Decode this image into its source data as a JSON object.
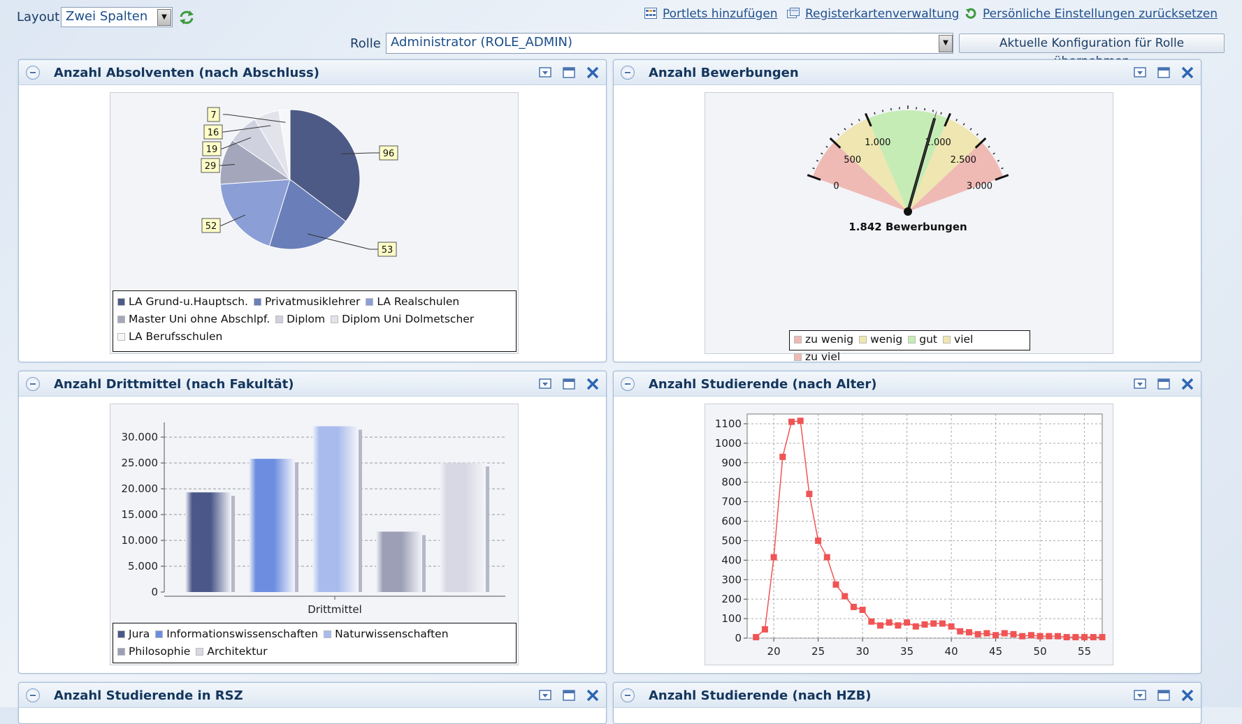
{
  "toolbar": {
    "layout_label": "Layout",
    "layout_value": "Zwei Spalten",
    "role_label": "Rolle",
    "role_value": "Administrator (ROLE_ADMIN)",
    "apply_button": "Aktuelle Konfiguration für Rolle übernehmen",
    "links": {
      "add_portlets": "Portlets hinzufügen",
      "tabs_admin": "Registerkartenverwaltung",
      "reset_settings": "Persönliche Einstellungen zurücksetzen"
    }
  },
  "portlets": {
    "absolventen": {
      "title": "Anzahl Absolventen (nach Abschluss)"
    },
    "bewerbungen": {
      "title": "Anzahl Bewerbungen"
    },
    "drittmittel": {
      "title": "Anzahl Drittmittel (nach Fakultät)"
    },
    "alter": {
      "title": "Anzahl Studierende (nach Alter)"
    },
    "rsz": {
      "title": "Anzahl Studierende in RSZ"
    },
    "hzb": {
      "title": "Anzahl Studierende (nach HZB)"
    }
  },
  "chart_data": [
    {
      "type": "pie",
      "slices": [
        {
          "label": "LA Grund-u.Hauptsch.",
          "value": 96,
          "color": "#4e5a86"
        },
        {
          "label": "Privatmusiklehrer",
          "value": 53,
          "color": "#6a7fb9"
        },
        {
          "label": "LA Realschulen",
          "value": 52,
          "color": "#8c9ed6"
        },
        {
          "label": "Master Uni ohne Abschlpf.",
          "value": 29,
          "color": "#a4a7bb"
        },
        {
          "label": "Diplom",
          "value": 19,
          "color": "#cfd1df"
        },
        {
          "label": "Diplom Uni Dolmetscher",
          "value": 16,
          "color": "#e3e4eb"
        },
        {
          "label": "LA Berufsschulen",
          "value": 7,
          "color": "#f7f7f9"
        }
      ]
    },
    {
      "type": "gauge",
      "value": 1842,
      "value_label": "1.842 Bewerbungen",
      "range": [
        0,
        3000
      ],
      "tick_labels": [
        "0",
        "500",
        "1.000",
        "2.000",
        "2.500",
        "3.000"
      ],
      "tick_values": [
        0,
        500,
        1000,
        2000,
        2500,
        3000
      ],
      "bands": [
        {
          "label": "zu wenig",
          "from": 0,
          "to": 500,
          "color": "#efb9b4"
        },
        {
          "label": "wenig",
          "from": 500,
          "to": 1000,
          "color": "#efe6b1"
        },
        {
          "label": "gut",
          "from": 1000,
          "to": 2000,
          "color": "#c5ecb4"
        },
        {
          "label": "viel",
          "from": 2000,
          "to": 2500,
          "color": "#efe6b1"
        },
        {
          "label": "zu viel",
          "from": 2500,
          "to": 3000,
          "color": "#efb9b4"
        }
      ]
    },
    {
      "type": "bar",
      "xlabel": "Drittmittel",
      "ylim": [
        0,
        30000
      ],
      "yticks": [
        0,
        5000,
        10000,
        15000,
        20000,
        25000,
        30000
      ],
      "ytick_labels": [
        "0",
        "5.000",
        "10.000",
        "15.000",
        "20.000",
        "25.000",
        "30.000"
      ],
      "series": [
        {
          "name": "Jura",
          "value": 19300,
          "color": "#4a5788"
        },
        {
          "name": "Informationswissenschaften",
          "value": 25800,
          "color": "#6d8ee0"
        },
        {
          "name": "Naturwissenschaften",
          "value": 32100,
          "color": "#a8bbec"
        },
        {
          "name": "Philosophie",
          "value": 11700,
          "color": "#9c9fb5"
        },
        {
          "name": "Architektur",
          "value": 25000,
          "color": "#d7d8e3"
        }
      ]
    },
    {
      "type": "line",
      "xlim": [
        17,
        57
      ],
      "ylim": [
        0,
        1150
      ],
      "xticks": [
        20,
        25,
        30,
        35,
        40,
        45,
        50,
        55
      ],
      "yticks": [
        0,
        100,
        200,
        300,
        400,
        500,
        600,
        700,
        800,
        900,
        1000,
        1100
      ],
      "color": "#f05454",
      "x": [
        18,
        19,
        20,
        21,
        22,
        23,
        24,
        25,
        26,
        27,
        28,
        29,
        30,
        31,
        32,
        33,
        34,
        35,
        36,
        37,
        38,
        39,
        40,
        41,
        42,
        43,
        44,
        45,
        46,
        47,
        48,
        49,
        50,
        51,
        52,
        53,
        54,
        55,
        56,
        57
      ],
      "y": [
        5,
        45,
        415,
        930,
        1110,
        1115,
        740,
        500,
        415,
        275,
        215,
        160,
        145,
        85,
        65,
        80,
        65,
        80,
        60,
        70,
        75,
        75,
        60,
        35,
        30,
        20,
        25,
        15,
        25,
        20,
        10,
        15,
        10,
        10,
        10,
        5,
        5,
        5,
        5,
        5
      ]
    }
  ]
}
